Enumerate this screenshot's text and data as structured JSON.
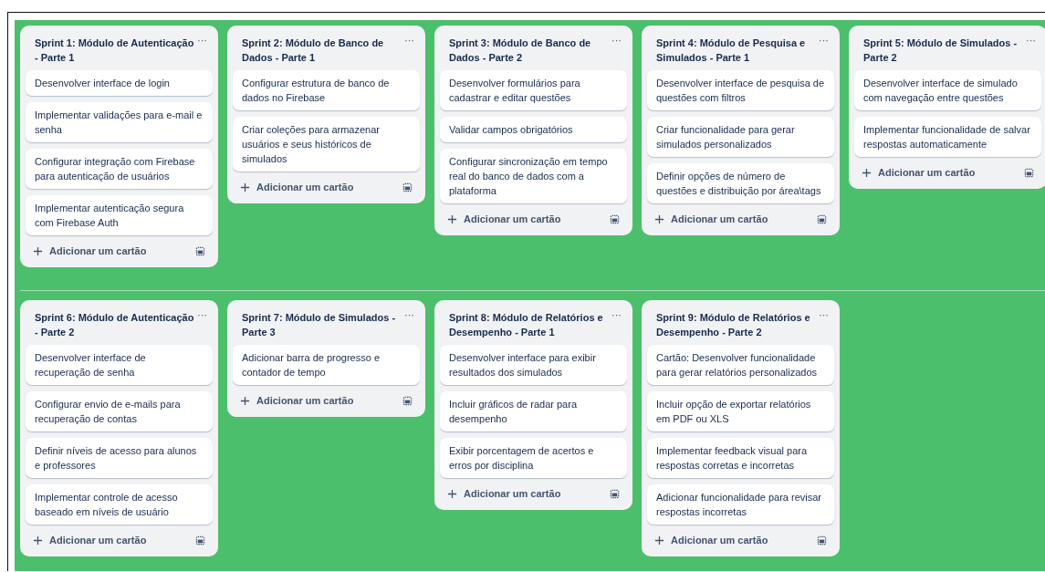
{
  "rows": [
    {
      "lists": [
        {
          "title": "Sprint 1: Módulo de Autenticação - Parte 1",
          "menu": "···",
          "add_label": "Adicionar um cartão",
          "cards": [
            "Desenvolver interface de login",
            "Implementar validações para e-mail e senha",
            "Configurar integração com Firebase para autenticação de usuários",
            "Implementar autenticação segura com Firebase Auth"
          ]
        },
        {
          "title": "Sprint 2: Módulo de Banco de Dados - Parte 1",
          "menu": "···",
          "add_label": "Adicionar um cartão",
          "cards": [
            "Configurar estrutura de banco de dados no Firebase",
            "Criar coleções para armazenar usuários e seus históricos de simulados"
          ]
        },
        {
          "title": "Sprint 3: Módulo de Banco de Dados - Parte 2",
          "menu": "···",
          "add_label": "Adicionar um cartão",
          "cards": [
            "Desenvolver formulários para cadastrar e editar questões",
            "Validar campos obrigatórios",
            "Configurar sincronização em tempo real do banco de dados com a plataforma"
          ]
        },
        {
          "title": "Sprint 4: Módulo de Pesquisa e Simulados - Parte 1",
          "menu": "···",
          "add_label": "Adicionar um cartão",
          "cards": [
            "Desenvolver interface de pesquisa de questões com filtros",
            "Criar funcionalidade para gerar simulados personalizados",
            "Definir opções de número de questões e distribuição por área\\tags"
          ]
        },
        {
          "title": "Sprint 5: Módulo de Simulados - Parte 2",
          "menu": "···",
          "add_label": "Adicionar um cartão",
          "cards": [
            "Desenvolver interface de simulado com navegação entre questões",
            "Implementar funcionalidade de salvar respostas automaticamente"
          ]
        }
      ]
    },
    {
      "lists": [
        {
          "title": "Sprint 6: Módulo de Autenticação - Parte 2",
          "menu": "···",
          "add_label": "Adicionar um cartão",
          "cards": [
            "Desenvolver interface de recuperação de senha",
            "Configurar envio de e-mails para recuperação de contas",
            "Definir níveis de acesso para alunos e professores",
            "Implementar controle de acesso baseado em níveis de usuário"
          ]
        },
        {
          "title": "Sprint 7: Módulo de Simulados - Parte 3",
          "menu": "···",
          "add_label": "Adicionar um cartão",
          "cards": [
            "Adicionar barra de progresso e contador de tempo"
          ]
        },
        {
          "title": "Sprint 8: Módulo de Relatórios e Desempenho - Parte 1",
          "menu": "···",
          "add_label": "Adicionar um cartão",
          "cards": [
            "Desenvolver interface para exibir resultados dos simulados",
            "Incluir gráficos de radar para desempenho",
            "Exibir porcentagem de acertos e erros por disciplina"
          ]
        },
        {
          "title": "Sprint 9: Módulo de Relatórios e Desempenho - Parte 2",
          "menu": "···",
          "add_label": "Adicionar um cartão",
          "cards": [
            "Cartão: Desenvolver funcionalidade para gerar relatórios personalizados",
            "Incluir opção de exportar relatórios em PDF ou XLS",
            "Implementar feedback visual para respostas corretas e incorretas",
            "Adicionar funcionalidade para revisar respostas incorretas"
          ]
        }
      ]
    }
  ]
}
